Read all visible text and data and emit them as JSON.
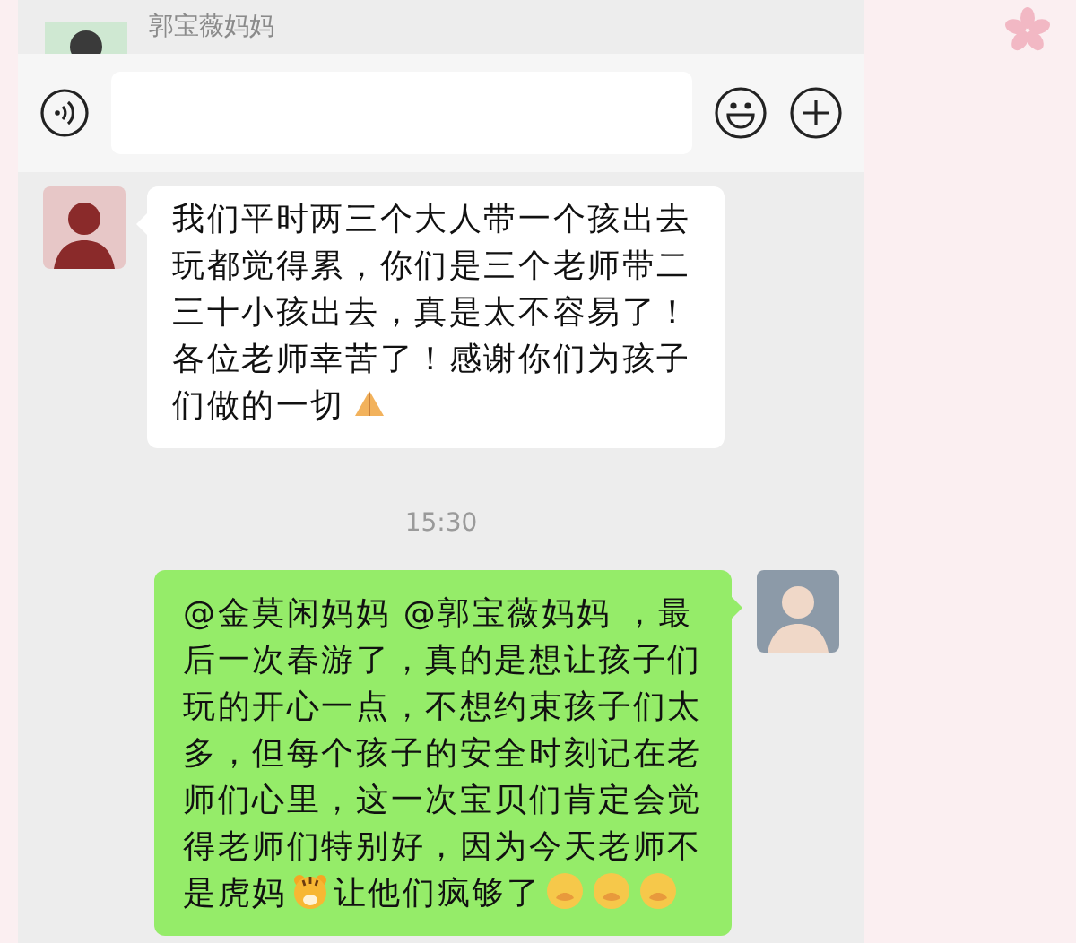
{
  "header": {
    "sender_name": "郭宝薇妈妈"
  },
  "messages": [
    {
      "kind": "received",
      "parts": [
        {
          "kind": "text",
          "text": "我们平时两三个大人带一个孩出去玩都觉得累，你们是三个老师带二三十小孩出去，真是太不容易了！各位老师幸苦了！感谢你们为孩子们做的一切"
        },
        {
          "kind": "hands"
        }
      ]
    },
    {
      "kind": "time",
      "text": "15:30"
    },
    {
      "kind": "sent",
      "parts": [
        {
          "kind": "text",
          "text": "@金莫闲妈妈 @郭宝薇妈妈 ，最后一次春游了，真的是想让孩子们玩的开心一点，不想约束孩子们太多，但每个孩子的安全时刻记在老师们心里，这一次宝贝们肯定会觉得老师们特别好，因为今天老师不是虎妈"
        },
        {
          "kind": "tiger"
        },
        {
          "kind": "text",
          "text": "让他们疯够了"
        },
        {
          "kind": "grin"
        },
        {
          "kind": "grin"
        },
        {
          "kind": "grin"
        }
      ]
    }
  ]
}
